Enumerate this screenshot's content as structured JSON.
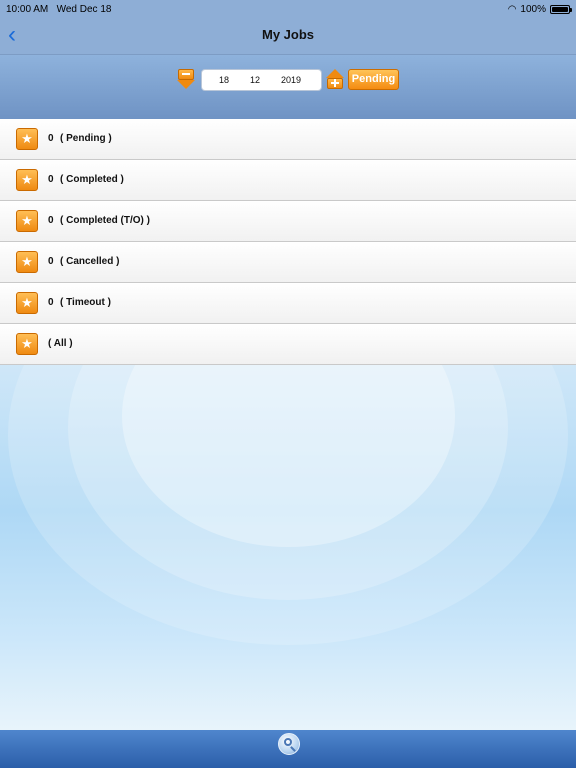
{
  "status_bar": {
    "time": "10:00 AM",
    "date": "Wed Dec 18",
    "battery": "100%"
  },
  "nav": {
    "back_icon": "chevron-left-icon",
    "title": "My Jobs"
  },
  "toolbar": {
    "date_day": "18",
    "date_month": "12",
    "date_year": "2019",
    "filter_button_label": "Pending"
  },
  "jobs": [
    {
      "count": "0",
      "label": "( Pending )"
    },
    {
      "count": "0",
      "label": "( Completed )"
    },
    {
      "count": "0",
      "label": "( Completed (T/O) )"
    },
    {
      "count": "0",
      "label": "( Cancelled )"
    },
    {
      "count": "0",
      "label": "( Timeout )"
    },
    {
      "count": "",
      "label": "( All )"
    }
  ],
  "colors": {
    "accent": "#f48c12",
    "nav_bg": "#8eaed6",
    "bottom_bar": "#2b5ea9"
  },
  "icons": {
    "list_item": "star-icon",
    "prev": "decrement-arrow-icon",
    "next": "increment-arrow-icon",
    "bottom": "search-icon"
  }
}
